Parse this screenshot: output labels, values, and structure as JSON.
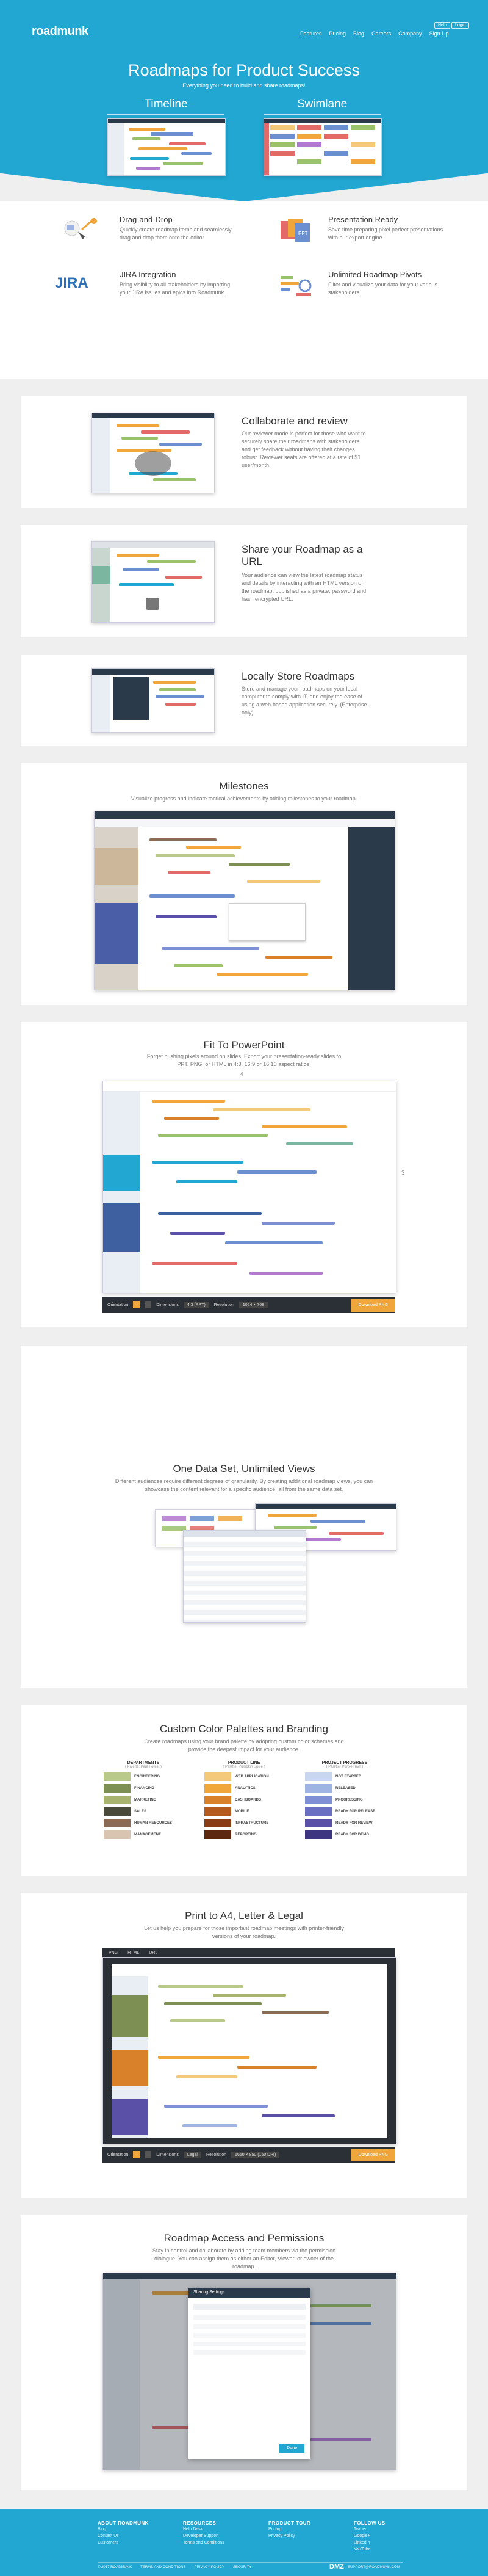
{
  "brand": {
    "logo": "roadmunk",
    "accent": "#22a7d2"
  },
  "header": {
    "nav": [
      "Features",
      "Pricing",
      "Blog",
      "Careers",
      "Company",
      "Sign Up"
    ],
    "active_nav": "Features",
    "help_label": "Help",
    "login_label": "Login"
  },
  "hero": {
    "title": "Roadmaps for Product Success",
    "subtitle": "Everything you need to build and share roadmaps!",
    "tabs": [
      "Timeline",
      "Swimlane"
    ]
  },
  "features": [
    {
      "icon": "drag-drop-icon",
      "title": "Drag-and-Drop",
      "desc": "Quickly create roadmap items and seamlessly drag and drop them onto the editor."
    },
    {
      "icon": "presentation-icon",
      "title": "Presentation Ready",
      "desc": "Save time preparing pixel perfect presentations with our export engine."
    },
    {
      "icon": "jira-icon",
      "title": "JIRA Integration",
      "desc": "Bring visibility to all stakeholders by importing your JIRA issues and epics into Roadmunk.",
      "logo_text": "JIRA"
    },
    {
      "icon": "pivot-icon",
      "title": "Unlimited Roadmap Pivots",
      "desc": "Filter and visualize your data for your various stakeholders."
    }
  ],
  "sections": {
    "collaborate": {
      "title": "Collaborate and review",
      "desc": "Our reviewer mode is perfect for those who want to securely share their roadmaps with stakeholders and get feedback without having their changes robust. Reviewer seats are offered at a rate of $1 user/month."
    },
    "share": {
      "title": "Share your Roadmap as a URL",
      "desc": "Your audience can view the latest roadmap status and details by interacting with an HTML version of the roadmap, published as a private, password and hash encrypted URL."
    },
    "local": {
      "title": "Locally Store Roadmaps",
      "desc": "Store and manage your roadmaps on your local computer to comply with IT, and enjoy the ease of using a web-based application securely. (Enterprise only)"
    },
    "milestones": {
      "title": "Milestones",
      "desc": "Visualize progress and indicate tactical achievements by adding milestones to your roadmap."
    },
    "powerpoint": {
      "title": "Fit To PowerPoint",
      "desc": "Forget pushing pixels around on slides. Export your presentation-ready slides to PPT, PNG, or HTML in 4:3, 16:9 or 16:10 aspect ratios.",
      "dim_w": "4",
      "dim_h": "3",
      "toolbar": {
        "orientation_label": "Orientation",
        "dimension_label": "Dimensions",
        "dimension_value": "4:3 (PPT)",
        "resolution_label": "Resolution",
        "resolution_value": "1024 × 768",
        "download_label": "Download PNG"
      }
    },
    "views": {
      "title": "One Data Set, Unlimited Views",
      "desc": "Different audiences require different degrees of granularity. By creating additional roadmap views, you can showcase the content relevant for a specific audience, all from the same data set."
    },
    "palettes": {
      "title": "Custom Color Palettes and Branding",
      "desc": "Create roadmaps using your brand palette by adopting custom color schemes and provide the deepest impact for your audience."
    },
    "print": {
      "title": "Print to A4, Letter & Legal",
      "desc": "Let us help you prepare for those important roadmap meetings with printer-friendly versions of your roadmap.",
      "formats": [
        "PNG",
        "HTML",
        "URL"
      ],
      "toolbar": {
        "orientation_label": "Orientation",
        "dimension_label": "Dimensions",
        "dimension_value": "Legal",
        "resolution_label": "Resolution",
        "resolution_value": "1650 × 850 (150 DPI)",
        "download_label": "Download PNG"
      }
    },
    "permissions": {
      "title": "Roadmap Access and Permissions",
      "desc": "Stay in control and collaborate by adding team members via the permission dialogue. You can assign them as either an Editor, Viewer, or owner of the roadmap.",
      "dialog_title": "Sharing Settings",
      "dialog_button": "Done"
    }
  },
  "palettes": [
    {
      "header": "DEPARTMENTS",
      "sub": "( Palette: Pine Forest )",
      "items": [
        {
          "label": "ENGINEERING",
          "color": "#b9c98a"
        },
        {
          "label": "FINANCING",
          "color": "#7d8f52"
        },
        {
          "label": "MARKETING",
          "color": "#a8b46d"
        },
        {
          "label": "SALES",
          "color": "#4a4a3a"
        },
        {
          "label": "HUMAN RESOURCES",
          "color": "#8a6b55"
        },
        {
          "label": "MANAGEMENT",
          "color": "#d8c4b0"
        }
      ]
    },
    {
      "header": "PRODUCT LINE",
      "sub": "( Palette: Pumpkin Spice )",
      "items": [
        {
          "label": "WEB APPLICATION",
          "color": "#f4c97a"
        },
        {
          "label": "ANALYTICS",
          "color": "#f0a63a"
        },
        {
          "label": "DASHBOARDS",
          "color": "#d9812a"
        },
        {
          "label": "MOBILE",
          "color": "#b55a1e"
        },
        {
          "label": "INFRASTRUCTURE",
          "color": "#8a3d14"
        },
        {
          "label": "REPORTING",
          "color": "#5c2810"
        }
      ]
    },
    {
      "header": "PROJECT PROGRESS",
      "sub": "( Palette: Purple Rain )",
      "items": [
        {
          "label": "NOT STARTED",
          "color": "#c9d6ef"
        },
        {
          "label": "RELEASED",
          "color": "#9fb4e3"
        },
        {
          "label": "PROGRESSING",
          "color": "#7f8fd6"
        },
        {
          "label": "READY FOR RELEASE",
          "color": "#6a6fc4"
        },
        {
          "label": "READY FOR REVIEW",
          "color": "#5a50a8"
        },
        {
          "label": "READY FOR DEMO",
          "color": "#3e3580"
        }
      ]
    }
  ],
  "footer": {
    "columns": [
      {
        "title": "ABOUT ROADMUNK",
        "items": [
          "Blog",
          "Contact Us",
          "Customers"
        ]
      },
      {
        "title": "RESOURCES",
        "items": [
          "Help Desk",
          "Developer Support",
          "Terms and Conditions"
        ]
      },
      {
        "title": "PRODUCT TOUR",
        "items": [
          "Pricing",
          "Privacy Policy"
        ]
      },
      {
        "title": "FOLLOW US",
        "items": [
          "Twitter",
          "Google+",
          "LinkedIn",
          "YouTube"
        ]
      }
    ],
    "copyright": "© 2017 ROADMUNK",
    "links": [
      "TERMS AND CONDITIONS",
      "PRIVACY POLICY",
      "SECURITY"
    ],
    "partner": "DMZ",
    "email": "SUPPORT@ROADMUNK.COM"
  }
}
